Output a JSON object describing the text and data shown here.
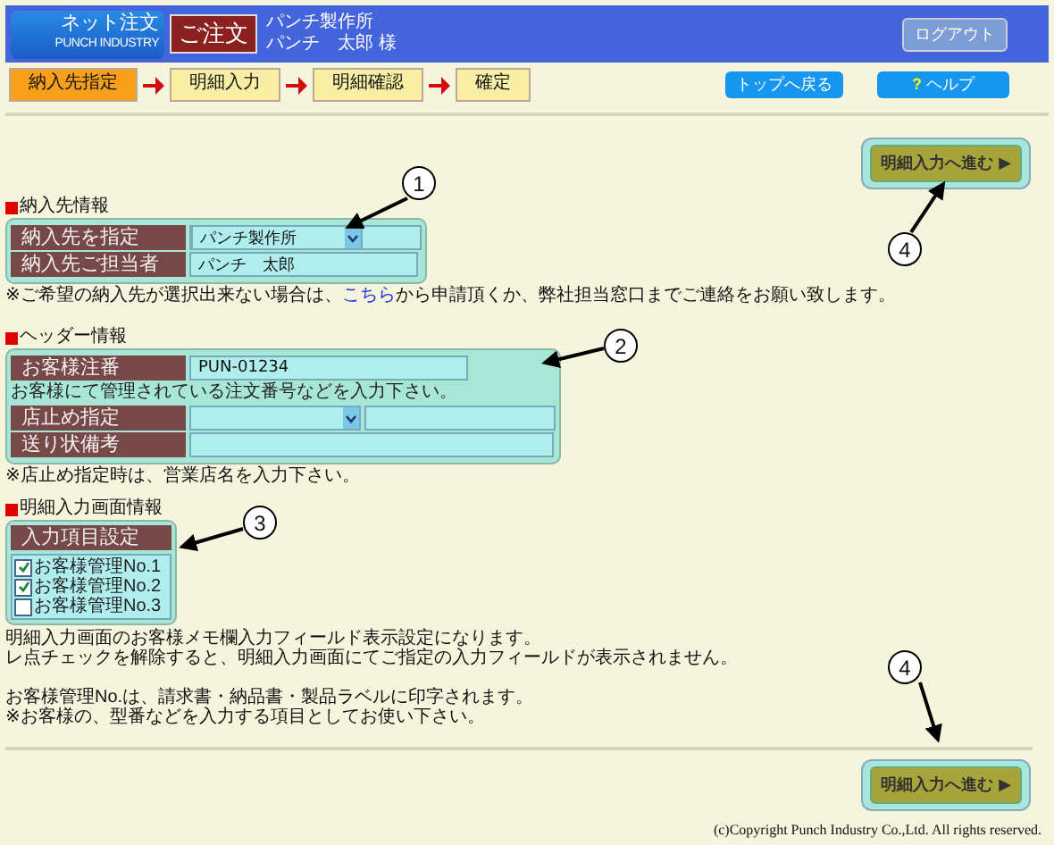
{
  "header": {
    "logo_title": "ネット注文",
    "logo_subtitle": "PUNCH INDUSTRY",
    "page_badge": "ご注文",
    "company": "パンチ製作所",
    "user": "パンチ　太郎 様",
    "logout": "ログアウト"
  },
  "steps": [
    {
      "label": "納入先指定",
      "selected": true
    },
    {
      "label": "明細入力",
      "selected": false
    },
    {
      "label": "明細確認",
      "selected": false
    },
    {
      "label": "確定",
      "selected": false
    }
  ],
  "nav_buttons": [
    {
      "label": "トップへ戻る"
    },
    {
      "icon": "?",
      "label": "ヘルプ"
    }
  ],
  "next_buttons": [
    {
      "label": "明細入力へ進む ▶"
    },
    {
      "label": "明細入力へ進む ▶"
    }
  ],
  "delivery": {
    "heading": "納入先情報",
    "rows": [
      {
        "kind": "select",
        "label": "納入先を指定",
        "value": "パンチ製作所"
      },
      {
        "kind": "text",
        "label": "納入先ご担当者",
        "value": "パンチ　太郎"
      }
    ],
    "note": {
      "before": "※ご希望の納入先が選択出来ない場合は、",
      "link": "こちら",
      "after": "から申請頂くか、弊社担当窓口までご連絡をお願い致します。"
    }
  },
  "header_info": {
    "heading": "ヘッダー情報",
    "rows": [
      {
        "kind": "short_text",
        "label": "お客様注番",
        "value": "PUN-01234"
      },
      {
        "kind": "hint",
        "text": "お客様にて管理されている注文番号などを入力下さい。"
      },
      {
        "kind": "select_text",
        "label": "店止め指定"
      },
      {
        "kind": "text",
        "label": "送り状備考"
      }
    ],
    "note": "※店止め指定時は、営業店名を入力下さい。"
  },
  "screen_info": {
    "heading": "明細入力画面情報",
    "box_title": "入力項目設定",
    "options": [
      {
        "label": "お客様管理No.1",
        "checked": true
      },
      {
        "label": "お客様管理No.2",
        "checked": true
      },
      {
        "label": "お客様管理No.3",
        "checked": false
      }
    ],
    "paragraphs": [
      [
        "明細入力画面のお客様メモ欄入力フィールド表示設定になります。",
        "レ点チェックを解除すると、明細入力画面にてご指定の入力フィールドが表示されません。"
      ],
      [
        "お客様管理No.は、請求書・納品書・製品ラベルに印字されます。",
        "※お客様の、型番などを入力する項目としてお使い下さい。"
      ]
    ]
  },
  "callouts": [
    {
      "number": "1"
    },
    {
      "number": "2"
    },
    {
      "number": "3"
    },
    {
      "number": "4"
    },
    {
      "number": "4"
    }
  ],
  "copyright": "(c)Copyright Punch Industry Co.,Ltd. All rights reserved."
}
